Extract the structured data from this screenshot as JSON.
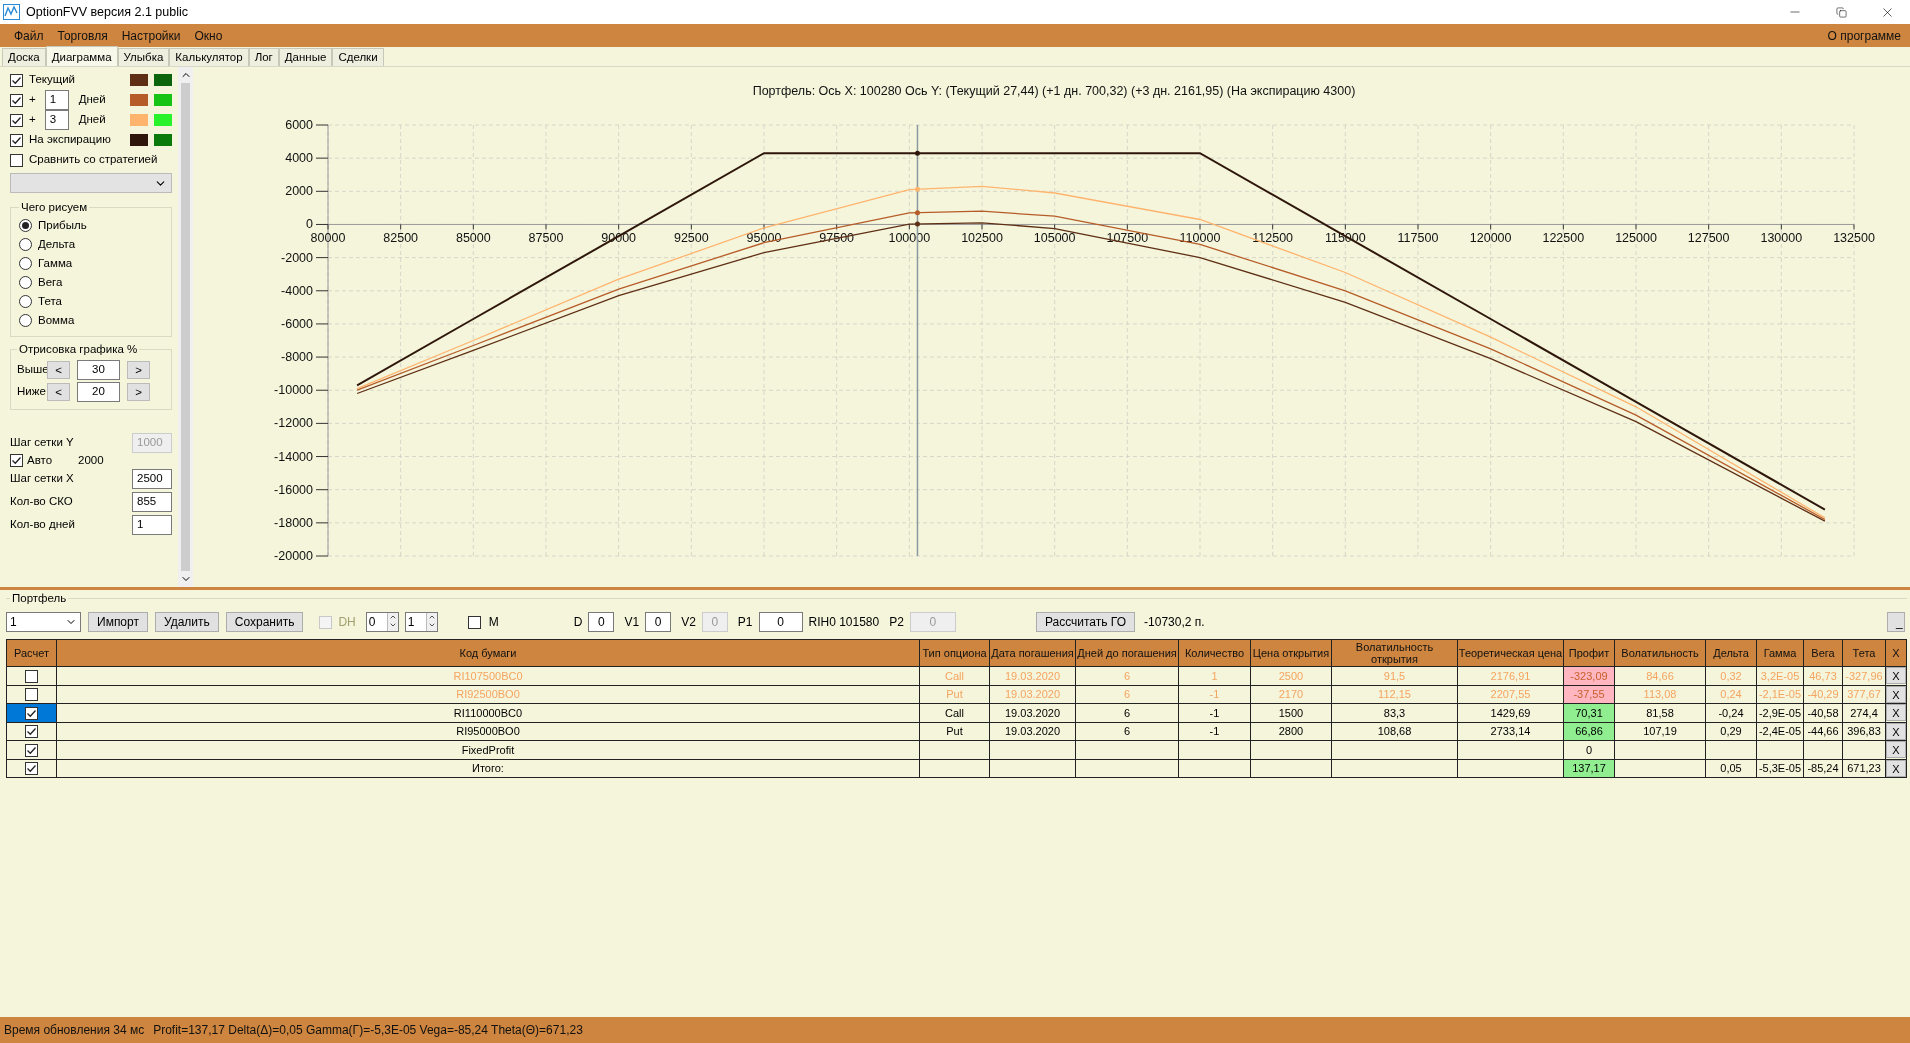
{
  "window": {
    "title": "OptionFVV версия 2.1 public"
  },
  "menu": [
    "Файл",
    "Торговля",
    "Настройки",
    "Окно"
  ],
  "menu_right": "О программе",
  "tabs": [
    {
      "label": "Доска",
      "selected": false
    },
    {
      "label": "Диаграмма",
      "selected": true
    },
    {
      "label": "Улыбка",
      "selected": false
    },
    {
      "label": "Калькулятор",
      "selected": false
    },
    {
      "label": "Лог",
      "selected": false
    },
    {
      "label": "Данные",
      "selected": false
    },
    {
      "label": "Сделки",
      "selected": false
    }
  ],
  "legend": [
    {
      "kind": "fixed",
      "checked": true,
      "label": "Текущий",
      "swatches": [
        {
          "color": "#5e2f14"
        },
        {
          "color": "#0c640c"
        }
      ]
    },
    {
      "kind": "days",
      "checked": true,
      "prefix": "+",
      "days": "1",
      "unit": "Дней",
      "swatches": [
        {
          "color": "#b65c28"
        },
        {
          "color": "#16c416"
        }
      ]
    },
    {
      "kind": "days",
      "checked": true,
      "prefix": "+",
      "days": "3",
      "unit": "Дней",
      "swatches": [
        {
          "color": "#ffb46e"
        },
        {
          "color": "#2af22a"
        }
      ]
    },
    {
      "kind": "fixed",
      "checked": true,
      "label": "На экспирацию",
      "swatches": [
        {
          "color": "#2e170a"
        },
        {
          "color": "#0a7a0a"
        }
      ]
    }
  ],
  "compare": {
    "checked": false,
    "label": "Сравнить со стратегией"
  },
  "draw_group": {
    "title": "Чего рисуем",
    "options": [
      {
        "label": "Прибыль",
        "selected": true
      },
      {
        "label": "Дельта",
        "selected": false
      },
      {
        "label": "Гамма",
        "selected": false
      },
      {
        "label": "Вега",
        "selected": false
      },
      {
        "label": "Тета",
        "selected": false
      },
      {
        "label": "Вомма",
        "selected": false
      }
    ]
  },
  "range_group": {
    "title": "Отрисовка графика %",
    "rows": [
      {
        "label": "Выше",
        "dec": "<",
        "value": "30",
        "inc": ">"
      },
      {
        "label": "Ниже",
        "dec": "<",
        "value": "20",
        "inc": ">"
      }
    ]
  },
  "grid": {
    "y_label": "Шаг сетки Y",
    "y_value": "1000",
    "y_disabled": true,
    "auto_checked": true,
    "auto_label": "Авто",
    "auto_value": "2000",
    "x_label": "Шаг сетки X",
    "x_value": "2500",
    "sko_label": "Кол-во СКО",
    "sko_value": "855",
    "days_label": "Кол-во дней",
    "days_value": "1"
  },
  "chart_data": {
    "type": "line",
    "title": "Портфель: Ось X: 100280 Ось Y:  (Текущий 27,44)  (+1 дн. 700,32)  (+3 дн. 2161,95)  (На экспирацию 4300)",
    "x": [
      81000,
      85000,
      90000,
      95000,
      100000,
      102500,
      105000,
      110000,
      115000,
      120000,
      125000,
      131500
    ],
    "series": [
      {
        "color": "#5e2f14",
        "values": [
          -10200,
          -7600,
          -4300,
          -1700,
          20,
          100,
          -250,
          -2000,
          -4700,
          -8100,
          -11900,
          -17900
        ]
      },
      {
        "color": "#b65c28",
        "values": [
          -10000,
          -7300,
          -3900,
          -1100,
          700,
          800,
          500,
          -1200,
          -4000,
          -7500,
          -11500,
          -17800
        ]
      },
      {
        "color": "#ffb46e",
        "values": [
          -9900,
          -7000,
          -3300,
          -200,
          2100,
          2300,
          1900,
          300,
          -2900,
          -6800,
          -11000,
          -17700
        ]
      },
      {
        "color": "#2e170a",
        "values": [
          -9700,
          -5700,
          -700,
          4300,
          4300,
          4300,
          4300,
          4300,
          -700,
          -5700,
          -10700,
          -17200
        ]
      }
    ],
    "xlim": [
      80000,
      132500
    ],
    "ylim": [
      -20000,
      6000
    ],
    "xticks": [
      80000,
      82500,
      85000,
      87500,
      90000,
      92500,
      95000,
      97500,
      100000,
      102500,
      105000,
      107500,
      110000,
      112500,
      115000,
      117500,
      120000,
      122500,
      125000,
      127500,
      130000,
      132500
    ],
    "yticks": [
      6000,
      4000,
      2000,
      0,
      -2000,
      -4000,
      -6000,
      -8000,
      -10000,
      -12000,
      -14000,
      -16000,
      -18000,
      -20000
    ],
    "grid": true,
    "ref_lines": [
      {
        "axis": "x",
        "value": 100280
      }
    ]
  },
  "portfolio": {
    "title": "Портфель",
    "select": "1",
    "buttons": [
      "Импорт",
      "Удалить",
      "Сохранить"
    ],
    "dh": {
      "label": "DH",
      "checked": false,
      "disabled": true
    },
    "spins": [
      "0",
      "1"
    ],
    "m": {
      "label": "M",
      "checked": false
    },
    "fields": [
      {
        "kind": "field",
        "label": "D",
        "value": "0",
        "disabled": false
      },
      {
        "kind": "field",
        "label": "V1",
        "value": "0",
        "disabled": false
      },
      {
        "kind": "field",
        "label": "V2",
        "value": "0",
        "disabled": true
      },
      {
        "kind": "field",
        "label": "P1",
        "value": "0",
        "disabled": false
      },
      {
        "kind": "text",
        "label": "RIH0 101580"
      },
      {
        "kind": "field",
        "label": "P2",
        "value": "0",
        "disabled": true
      }
    ],
    "calc_button": "Рассчитать ГО",
    "go_value": "-10730,2 п.",
    "collapse_button": "_"
  },
  "table": {
    "columns": [
      "Расчет",
      "Код бумаги",
      "Тип опциона",
      "Дата погашения",
      "Дней до погашения",
      "Количество",
      "Цена открытия",
      "Волатильность открытия",
      "Теоретическая цена",
      "Профит",
      "Волатильность",
      "Дельта",
      "Гамма",
      "Вега",
      "Тета",
      "X"
    ],
    "rows": [
      {
        "checked": false,
        "selected": false,
        "profit_highlight": true,
        "profit_negative": true,
        "cells": [
          "",
          "RI107500BC0",
          "Call",
          "19.03.2020",
          "6",
          "1",
          "2500",
          "91,5",
          "2176,91",
          "-323,09",
          "84,66",
          "0,32",
          "3,2E-05",
          "46,73",
          "-327,96",
          "X"
        ]
      },
      {
        "checked": false,
        "selected": false,
        "profit_highlight": true,
        "profit_negative": true,
        "cells": [
          "",
          "RI92500BO0",
          "Put",
          "19.03.2020",
          "6",
          "-1",
          "2170",
          "112,15",
          "2207,55",
          "-37,55",
          "113,08",
          "0,24",
          "-2,1E-05",
          "-40,29",
          "377,67",
          "X"
        ]
      },
      {
        "checked": true,
        "selected": true,
        "profit_highlight": true,
        "profit_negative": false,
        "cells": [
          "",
          "RI110000BC0",
          "Call",
          "19.03.2020",
          "6",
          "-1",
          "1500",
          "83,3",
          "1429,69",
          "70,31",
          "81,58",
          "-0,24",
          "-2,9E-05",
          "-40,58",
          "274,4",
          "X"
        ]
      },
      {
        "checked": true,
        "selected": false,
        "profit_highlight": true,
        "profit_negative": false,
        "cells": [
          "",
          "RI95000BO0",
          "Put",
          "19.03.2020",
          "6",
          "-1",
          "2800",
          "108,68",
          "2733,14",
          "66,86",
          "107,19",
          "0,29",
          "-2,4E-05",
          "-44,66",
          "396,83",
          "X"
        ]
      },
      {
        "checked": true,
        "selected": false,
        "profit_highlight": false,
        "cells": [
          "",
          "FixedProfit",
          "",
          "",
          "",
          "",
          "",
          "",
          "",
          "0",
          "",
          "",
          "",
          "",
          "",
          "X"
        ]
      },
      {
        "checked": true,
        "selected": false,
        "profit_highlight": true,
        "profit_negative": false,
        "cells": [
          "",
          "Итого:",
          "",
          "",
          "",
          "",
          "",
          "",
          "",
          "137,17",
          "",
          "0,05",
          "-5,3E-05",
          "-85,24",
          "671,23",
          "X"
        ]
      }
    ]
  },
  "status_bar": [
    "Время обновления 34 мс",
    "Profit=137,17 Delta(Δ)=0,05 Gamma(Γ)=-5,3E-05 Vega=-85,24 Theta(Θ)=671,23"
  ]
}
